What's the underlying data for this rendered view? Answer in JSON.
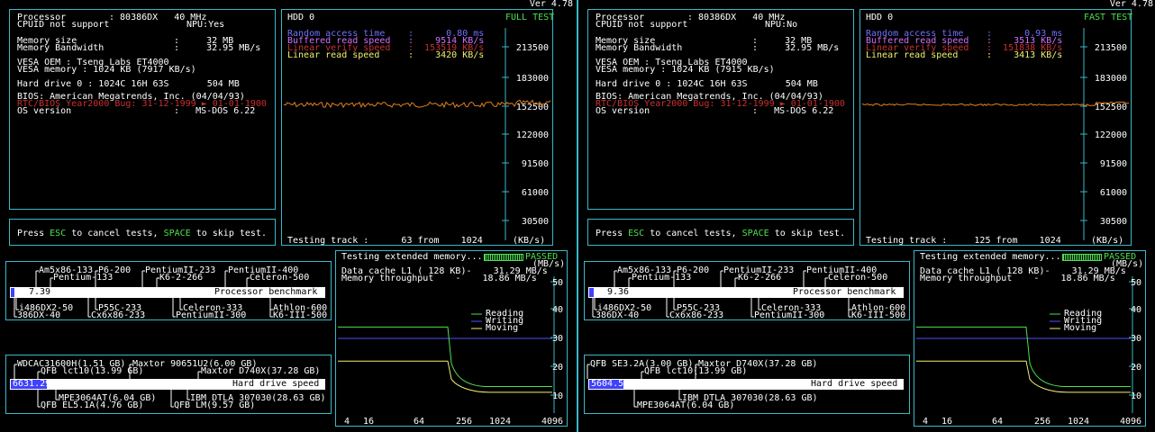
{
  "version": "Ver 4.78",
  "panels": [
    {
      "info": {
        "processor_label": "Processor",
        "processor_value": ": 80386DX   40 MHz",
        "cpuid": "CPUID not support",
        "npu": "NPU:Yes",
        "mem_size_label": "Memory size",
        "mem_size_value": ":     32 MB",
        "mem_bw_label": "Memory Bandwidth",
        "mem_bw_value": ":     32.95 MB/s",
        "vesa_oem": "VESA OEM : Tseng Labs ET4000",
        "vesa_mem": "VESA memory : 1024 KB (7917 KB/s)",
        "hdd": "Hard drive 0 : 1024C 16H 63S       504 MB",
        "bios": "BIOS: American Megatrends, Inc. (04/04/93)",
        "y2k": "RTC/BIOS Year2000 Bug: 31-12-1999 ► 01-01-1900",
        "os_label": "OS version",
        "os_value": ":   MS-DOS 6.22"
      },
      "press": {
        "p1": "Press ",
        "esc": "ESC",
        "p2": " to cancel tests, ",
        "space": "SPACE",
        "p3": " to skip test."
      },
      "hdd": {
        "title": "HDD 0",
        "mode": "FULL TEST",
        "random_label": "Random access time",
        "random_value": ":      0.80 ms",
        "buffered_label": "Buffered read speed",
        "buffered_value": ":    9514 KB/s",
        "verify_label": "Linear verify speed",
        "verify_value": ":  153519 KB/s",
        "linear_label": "Linear read speed",
        "linear_value": ":    3420 KB/s",
        "testing": "Testing track :      63 from    1024",
        "unit": "(KB/s)",
        "ticks": [
          "213500",
          "183000",
          "152500",
          "122000",
          "91500",
          "61000",
          "30500"
        ],
        "line_level": 152500,
        "noise": 6
      },
      "cpu_bench": {
        "top_labels": [
          {
            "text": "Am5x86-133",
            "x": 42,
            "y": 296
          },
          {
            "text": "P6-200",
            "x": 108,
            "y": 296
          },
          {
            "text": "PentiumII-233",
            "x": 160,
            "y": 296
          },
          {
            "text": "PentiumII-400",
            "x": 252,
            "y": 296
          },
          {
            "text": "Pentium-133",
            "x": 58,
            "y": 304
          },
          {
            "text": "K6-2-266",
            "x": 176,
            "y": 304
          },
          {
            "text": "Celeron-500",
            "x": 276,
            "y": 304
          }
        ],
        "bottom_labels": [
          {
            "text": "i486DX2-50",
            "x": 20,
            "y": 338
          },
          {
            "text": "P55C-233",
            "x": 108,
            "y": 338
          },
          {
            "text": "Celeron-333",
            "x": 202,
            "y": 338
          },
          {
            "text": "Athlon-600",
            "x": 302,
            "y": 338
          },
          {
            "text": "386DX-40",
            "x": 18,
            "y": 346
          },
          {
            "text": "Cx6x86-233",
            "x": 100,
            "y": 346
          },
          {
            "text": "PentiumII-300",
            "x": 194,
            "y": 346
          },
          {
            "text": "K6-III-500",
            "x": 302,
            "y": 346
          }
        ],
        "score": "7.39",
        "label": "Processor benchmark",
        "fill": 0.012
      },
      "hd_bench": {
        "top_labels": [
          {
            "text": "WDCAC31600H(1.51 GB)",
            "x": 18,
            "y": 400
          },
          {
            "text": "Maxtor 90651U2(6.00 GB)",
            "x": 146,
            "y": 400
          },
          {
            "text": "QFB lct10(13.99 GB)",
            "x": 44,
            "y": 408
          },
          {
            "text": "Maxtor D740X(37.28 GB)",
            "x": 222,
            "y": 408
          }
        ],
        "bottom_labels": [
          {
            "text": "MPE3064AT(6.04 GB)",
            "x": 64,
            "y": 438
          },
          {
            "text": "IBM DTLA 307030(28.63 GB)",
            "x": 210,
            "y": 438
          },
          {
            "text": "QFB EL5.1A(4.76 GB)",
            "x": 44,
            "y": 446
          },
          {
            "text": "QFB LM(9.57 GB)",
            "x": 192,
            "y": 446
          }
        ],
        "score": "6631.29",
        "label": "Hard drive speed",
        "fill": 0.115
      },
      "mem": {
        "line1": "Testing extended memory...",
        "passed": "PASSED",
        "unit": "(MB/s)",
        "l1": "Data cache L1 ( 128 KB)-    31.29 MB/s",
        "mt": "Memory throughput    -    18.86 MB/s",
        "yticks": [
          "50",
          "40",
          "30",
          "20",
          "10"
        ],
        "xticks": [
          "4",
          "16",
          "64",
          "256",
          "1024",
          "4096"
        ],
        "legend": [
          "Reading",
          "Writing",
          "Moving"
        ],
        "writing_level": 30,
        "reading_high": 34,
        "reading_low": 13,
        "moving_high": 22,
        "moving_low": 11
      }
    },
    {
      "info": {
        "processor_label": "Processor",
        "processor_value": ": 80386DX   40 MHz",
        "cpuid": "CPUID not support",
        "npu": "NPU:No",
        "mem_size_label": "Memory size",
        "mem_size_value": ":     32 MB",
        "mem_bw_label": "Memory Bandwidth",
        "mem_bw_value": ":     32.95 MB/s",
        "vesa_oem": "VESA OEM : Tseng Labs ET4000",
        "vesa_mem": "VESA memory : 1024 KB (7915 KB/s)",
        "hdd": "Hard drive 0 : 1024C 16H 63S       504 MB",
        "bios": "BIOS: American Megatrends, Inc. (04/04/93)",
        "y2k": "RTC/BIOS Year2000 Bug: 31-12-1999 ► 01-01-1900",
        "os_label": "OS version",
        "os_value": ":   MS-DOS 6.22"
      },
      "press": {
        "p1": "Press ",
        "esc": "ESC",
        "p2": " to cancel tests, ",
        "space": "SPACE",
        "p3": " to skip test."
      },
      "hdd": {
        "title": "HDD 0",
        "mode": "FAST TEST",
        "random_label": "Random access time",
        "random_value": ":      0.93 ms",
        "buffered_label": "Buffered read speed",
        "buffered_value": ":    3513 KB/s",
        "verify_label": "Linear verify speed",
        "verify_value": ":  151838 KB/s",
        "linear_label": "Linear read speed",
        "linear_value": ":    3413 KB/s",
        "testing": "Testing track :     125 from    1024",
        "unit": "(KB/s)",
        "ticks": [
          "213500",
          "183000",
          "152500",
          "122000",
          "91500",
          "61000",
          "30500"
        ],
        "line_level": 152500,
        "noise": 2
      },
      "cpu_bench": {
        "top_labels": [
          {
            "text": "Am5x86-133",
            "x": 42,
            "y": 296
          },
          {
            "text": "P6-200",
            "x": 108,
            "y": 296
          },
          {
            "text": "PentiumII-233",
            "x": 160,
            "y": 296
          },
          {
            "text": "PentiumII-400",
            "x": 252,
            "y": 296
          },
          {
            "text": "Pentium-133",
            "x": 58,
            "y": 304
          },
          {
            "text": "K6-2-266",
            "x": 176,
            "y": 304
          },
          {
            "text": "Celeron-500",
            "x": 276,
            "y": 304
          }
        ],
        "bottom_labels": [
          {
            "text": "i486DX2-50",
            "x": 20,
            "y": 338
          },
          {
            "text": "P55C-233",
            "x": 108,
            "y": 338
          },
          {
            "text": "Celeron-333",
            "x": 202,
            "y": 338
          },
          {
            "text": "Athlon-600",
            "x": 302,
            "y": 338
          },
          {
            "text": "386DX-40",
            "x": 18,
            "y": 346
          },
          {
            "text": "Cx6x86-233",
            "x": 100,
            "y": 346
          },
          {
            "text": "PentiumII-300",
            "x": 194,
            "y": 346
          },
          {
            "text": "K6-III-500",
            "x": 302,
            "y": 346
          }
        ],
        "score": "9.36",
        "label": "Processor benchmark",
        "fill": 0.014
      },
      "hd_bench": {
        "top_labels": [
          {
            "text": "QFB SE3.2A(3.00 GB)",
            "x": 12,
            "y": 400
          },
          {
            "text": "Maxtor D740X(37.28 GB)",
            "x": 132,
            "y": 400
          },
          {
            "text": "QFB lct10(13.99 GB)",
            "x": 72,
            "y": 408
          }
        ],
        "bottom_labels": [
          {
            "text": "IBM DTLA 307030(28.63 GB)",
            "x": 114,
            "y": 438
          },
          {
            "text": "MPE3064AT(6.04 GB)",
            "x": 64,
            "y": 446
          }
        ],
        "score": "5604.55",
        "label": "Hard drive speed",
        "fill": 0.11
      },
      "mem": {
        "line1": "Testing extended memory...",
        "passed": "PASSED",
        "unit": "(MB/s)",
        "l1": "Data cache L1 ( 128 KB)-    31.29 MB/s",
        "mt": "Memory throughput    -    18.86 MB/s",
        "yticks": [
          "50",
          "40",
          "30",
          "20",
          "10"
        ],
        "xticks": [
          "4",
          "16",
          "64",
          "256",
          "1024",
          "4096"
        ],
        "legend": [
          "Reading",
          "Writing",
          "Moving"
        ],
        "writing_level": 30,
        "reading_high": 34,
        "reading_low": 13,
        "moving_high": 22,
        "moving_low": 11
      }
    }
  ],
  "colors": {
    "border": "#3ab8c8",
    "hdd_line": "#e08020",
    "reading": "#4ee04e",
    "writing": "#5050ff",
    "moving": "#f0f070",
    "bar": "#4040ff"
  }
}
